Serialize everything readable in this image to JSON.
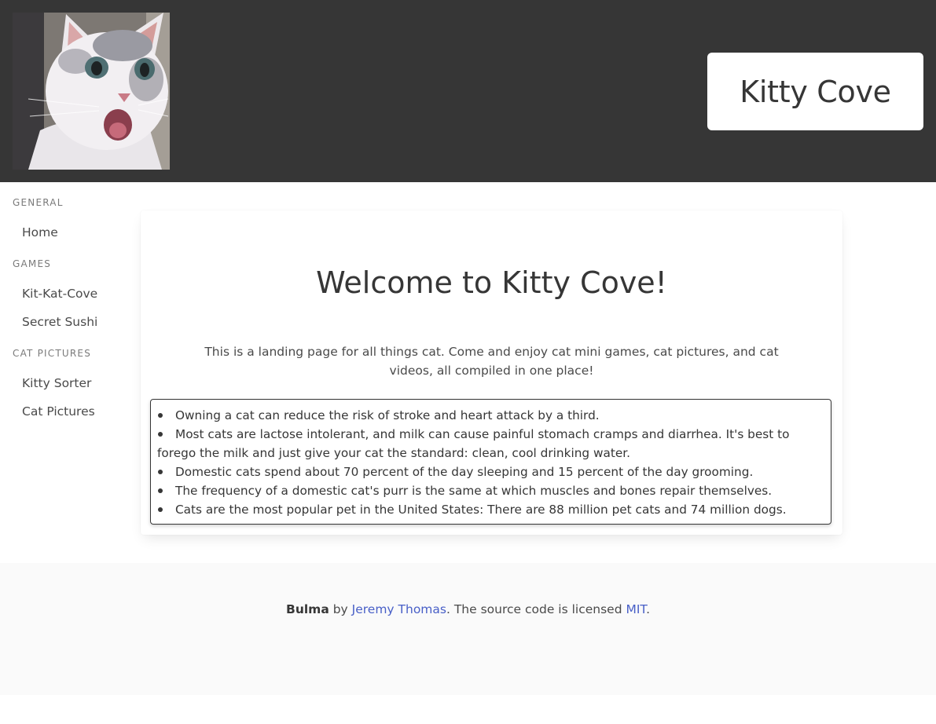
{
  "header": {
    "site_title": "Kitty Cove"
  },
  "sidebar": {
    "sections": [
      {
        "label": "General",
        "items": [
          "Home"
        ]
      },
      {
        "label": "Games",
        "items": [
          "Kit-Kat-Cove",
          "Secret Sushi"
        ]
      },
      {
        "label": "Cat Pictures",
        "items": [
          "Kitty Sorter",
          "Cat Pictures"
        ]
      }
    ]
  },
  "main": {
    "heading": "Welcome to Kitty Cove!",
    "intro": "This is a landing page for all things cat. Come and enjoy cat mini games, cat pictures, and cat videos, all compiled in one place!",
    "facts": [
      "Owning a cat can reduce the risk of stroke and heart attack by a third.",
      "Most cats are lactose intolerant, and milk can cause painful stomach cramps and diarrhea. It's best to forego the milk and just give your cat the standard: clean, cool drinking water.",
      "Domestic cats spend about 70 percent of the day sleeping and 15 percent of the day grooming.",
      "The frequency of a domestic cat's purr is the same at which muscles and bones repair themselves.",
      "Cats are the most popular pet in the United States: There are 88 million pet cats and 74 million dogs."
    ]
  },
  "footer": {
    "brand": "Bulma",
    "by": " by ",
    "author": "Jeremy Thomas",
    "middle": ". The source code is licensed ",
    "license": "MIT",
    "end": "."
  },
  "colors": {
    "header_bg": "#363636",
    "link": "#485fc7",
    "footer_bg": "#fafafa"
  }
}
